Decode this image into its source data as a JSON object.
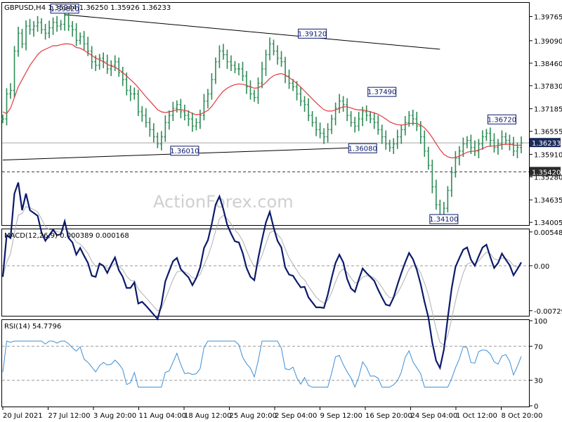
{
  "header": {
    "main": "GBPUSD,H4  1.35944 1.36250 1.35926 1.36233",
    "macd": "MACD(12,26,9) 0.000389 0.000168",
    "rsi": "RSI(14) 54.7796"
  },
  "watermark": "ActionForex.com",
  "colors": {
    "price": "#2e8b57",
    "ma": "#e0383e",
    "macd": "#0b1a6a",
    "signal": "#b0b0b0",
    "rsi": "#3d8fd6",
    "level_box_border": "#0b1a6a",
    "price_tag_bg": "#1c2a5a"
  },
  "chart_data": [
    {
      "type": "line",
      "name": "price",
      "title": "GBPUSD,H4  1.35944 1.36250 1.35926 1.36233",
      "ylim": [
        1.3395,
        1.4013
      ],
      "y_ticks": [
        "1.39765",
        "1.39090",
        "1.38460",
        "1.37830",
        "1.37185",
        "1.36555",
        "1.35910",
        "1.35280",
        "1.34635",
        "1.34005"
      ],
      "last_price_label": "1.36233",
      "support_label": "1.35420",
      "x_labels": [
        "20 Jul 2021",
        "27 Jul 12:00",
        "3 Aug 20:00",
        "11 Aug 04:00",
        "18 Aug 12:00",
        "25 Aug 20:00",
        "2 Sep 04:00",
        "9 Sep 12:00",
        "16 Sep 20:00",
        "24 Sep 04:00",
        "1 Oct 12:00",
        "8 Oct 20:00"
      ],
      "level_labels": [
        {
          "text": "1.39820",
          "bar": 16,
          "price": 1.3982,
          "side": "above"
        },
        {
          "text": "1.39120",
          "bar": 80,
          "price": 1.3912,
          "side": "above"
        },
        {
          "text": "1.37490",
          "bar": 98,
          "price": 1.3749,
          "side": "above"
        },
        {
          "text": "1.36720",
          "bar": 129,
          "price": 1.3672,
          "side": "above"
        },
        {
          "text": "1.36010",
          "bar": 51,
          "price": 1.3601,
          "side": "right"
        },
        {
          "text": "1.36080",
          "bar": 97,
          "price": 1.3608,
          "side": "right"
        },
        {
          "text": "1.34100",
          "bar": 114,
          "price": 1.341,
          "side": "below"
        }
      ],
      "trendlines": [
        {
          "from_bar": 16,
          "from_price": 1.3982,
          "to_bar": 113,
          "to_price": 1.3885
        },
        {
          "from_bar": 0,
          "from_price": 1.3575,
          "to_bar": 95,
          "to_price": 1.3611
        }
      ],
      "close": [
        1.369,
        1.376,
        1.377,
        1.388,
        1.393,
        1.39,
        1.395,
        1.394,
        1.395,
        1.396,
        1.394,
        1.393,
        1.3945,
        1.396,
        1.395,
        1.3955,
        1.398,
        1.395,
        1.394,
        1.391,
        1.392,
        1.39,
        1.388,
        1.385,
        1.384,
        1.386,
        1.385,
        1.383,
        1.384,
        1.385,
        1.382,
        1.38,
        1.377,
        1.376,
        1.376,
        1.371,
        1.37,
        1.368,
        1.366,
        1.364,
        1.362,
        1.364,
        1.368,
        1.37,
        1.372,
        1.373,
        1.371,
        1.37,
        1.369,
        1.367,
        1.368,
        1.37,
        1.374,
        1.376,
        1.38,
        1.385,
        1.388,
        1.387,
        1.385,
        1.384,
        1.383,
        1.383,
        1.381,
        1.378,
        1.376,
        1.375,
        1.379,
        1.383,
        1.387,
        1.39,
        1.388,
        1.386,
        1.385,
        1.381,
        1.379,
        1.378,
        1.376,
        1.374,
        1.373,
        1.37,
        1.368,
        1.366,
        1.365,
        1.364,
        1.366,
        1.369,
        1.372,
        1.374,
        1.373,
        1.37,
        1.368,
        1.367,
        1.369,
        1.371,
        1.37,
        1.369,
        1.368,
        1.366,
        1.364,
        1.362,
        1.361,
        1.362,
        1.364,
        1.366,
        1.368,
        1.37,
        1.369,
        1.367,
        1.364,
        1.36,
        1.356,
        1.35,
        1.345,
        1.342,
        1.344,
        1.349,
        1.354,
        1.358,
        1.36,
        1.362,
        1.363,
        1.361,
        1.36,
        1.362,
        1.364,
        1.365,
        1.363,
        1.361,
        1.362,
        1.364,
        1.363,
        1.362,
        1.36,
        1.361,
        1.3623
      ],
      "ma": [
        1.371,
        1.3705,
        1.372,
        1.375,
        1.378,
        1.38,
        1.382,
        1.384,
        1.3855,
        1.387,
        1.388,
        1.3885,
        1.389,
        1.3895,
        1.3895,
        1.3898,
        1.39,
        1.39,
        1.3898,
        1.389,
        1.3888,
        1.3882,
        1.3875,
        1.3868,
        1.386,
        1.3856,
        1.385,
        1.3843,
        1.3838,
        1.3835,
        1.3828,
        1.382,
        1.381,
        1.38,
        1.379,
        1.3778,
        1.3765,
        1.3752,
        1.374,
        1.3728,
        1.3716,
        1.371,
        1.3708,
        1.371,
        1.3712,
        1.3716,
        1.3716,
        1.3714,
        1.3711,
        1.3705,
        1.3702,
        1.3703,
        1.3708,
        1.3714,
        1.3725,
        1.374,
        1.3755,
        1.3768,
        1.3776,
        1.3782,
        1.3786,
        1.3788,
        1.3787,
        1.3784,
        1.378,
        1.3776,
        1.3777,
        1.3783,
        1.3792,
        1.3803,
        1.3811,
        1.3815,
        1.3817,
        1.3813,
        1.3806,
        1.3798,
        1.3789,
        1.3779,
        1.3768,
        1.3757,
        1.3746,
        1.3735,
        1.3725,
        1.3716,
        1.3712,
        1.3712,
        1.3715,
        1.372,
        1.3724,
        1.3724,
        1.3721,
        1.3717,
        1.3715,
        1.3715,
        1.3713,
        1.371,
        1.3707,
        1.3703,
        1.3697,
        1.369,
        1.3682,
        1.3677,
        1.3674,
        1.3673,
        1.3674,
        1.3677,
        1.3678,
        1.3677,
        1.3673,
        1.3665,
        1.3653,
        1.3638,
        1.3621,
        1.3604,
        1.3591,
        1.3584,
        1.3581,
        1.3582,
        1.3586,
        1.3591,
        1.3597,
        1.3599,
        1.36,
        1.3603,
        1.3607,
        1.3612,
        1.3614,
        1.3614,
        1.3615,
        1.3618,
        1.3619,
        1.3619,
        1.3617,
        1.3616,
        1.3617
      ]
    },
    {
      "type": "line",
      "name": "macd",
      "title": "MACD(12,26,9) 0.000389 0.000168",
      "ylim": [
        -0.008,
        0.0058
      ],
      "y_ticks": [
        "0.005484",
        "0.00",
        "-0.00729"
      ],
      "tick_values": [
        0.005484,
        0.0,
        -0.00729
      ]
    },
    {
      "type": "line",
      "name": "rsi",
      "title": "RSI(14) 54.7796",
      "ylim": [
        0,
        100
      ],
      "y_ticks": [
        "100",
        "70",
        "30",
        "0"
      ],
      "tick_values": [
        100,
        70,
        30,
        0
      ],
      "levels": [
        70,
        30
      ]
    }
  ]
}
